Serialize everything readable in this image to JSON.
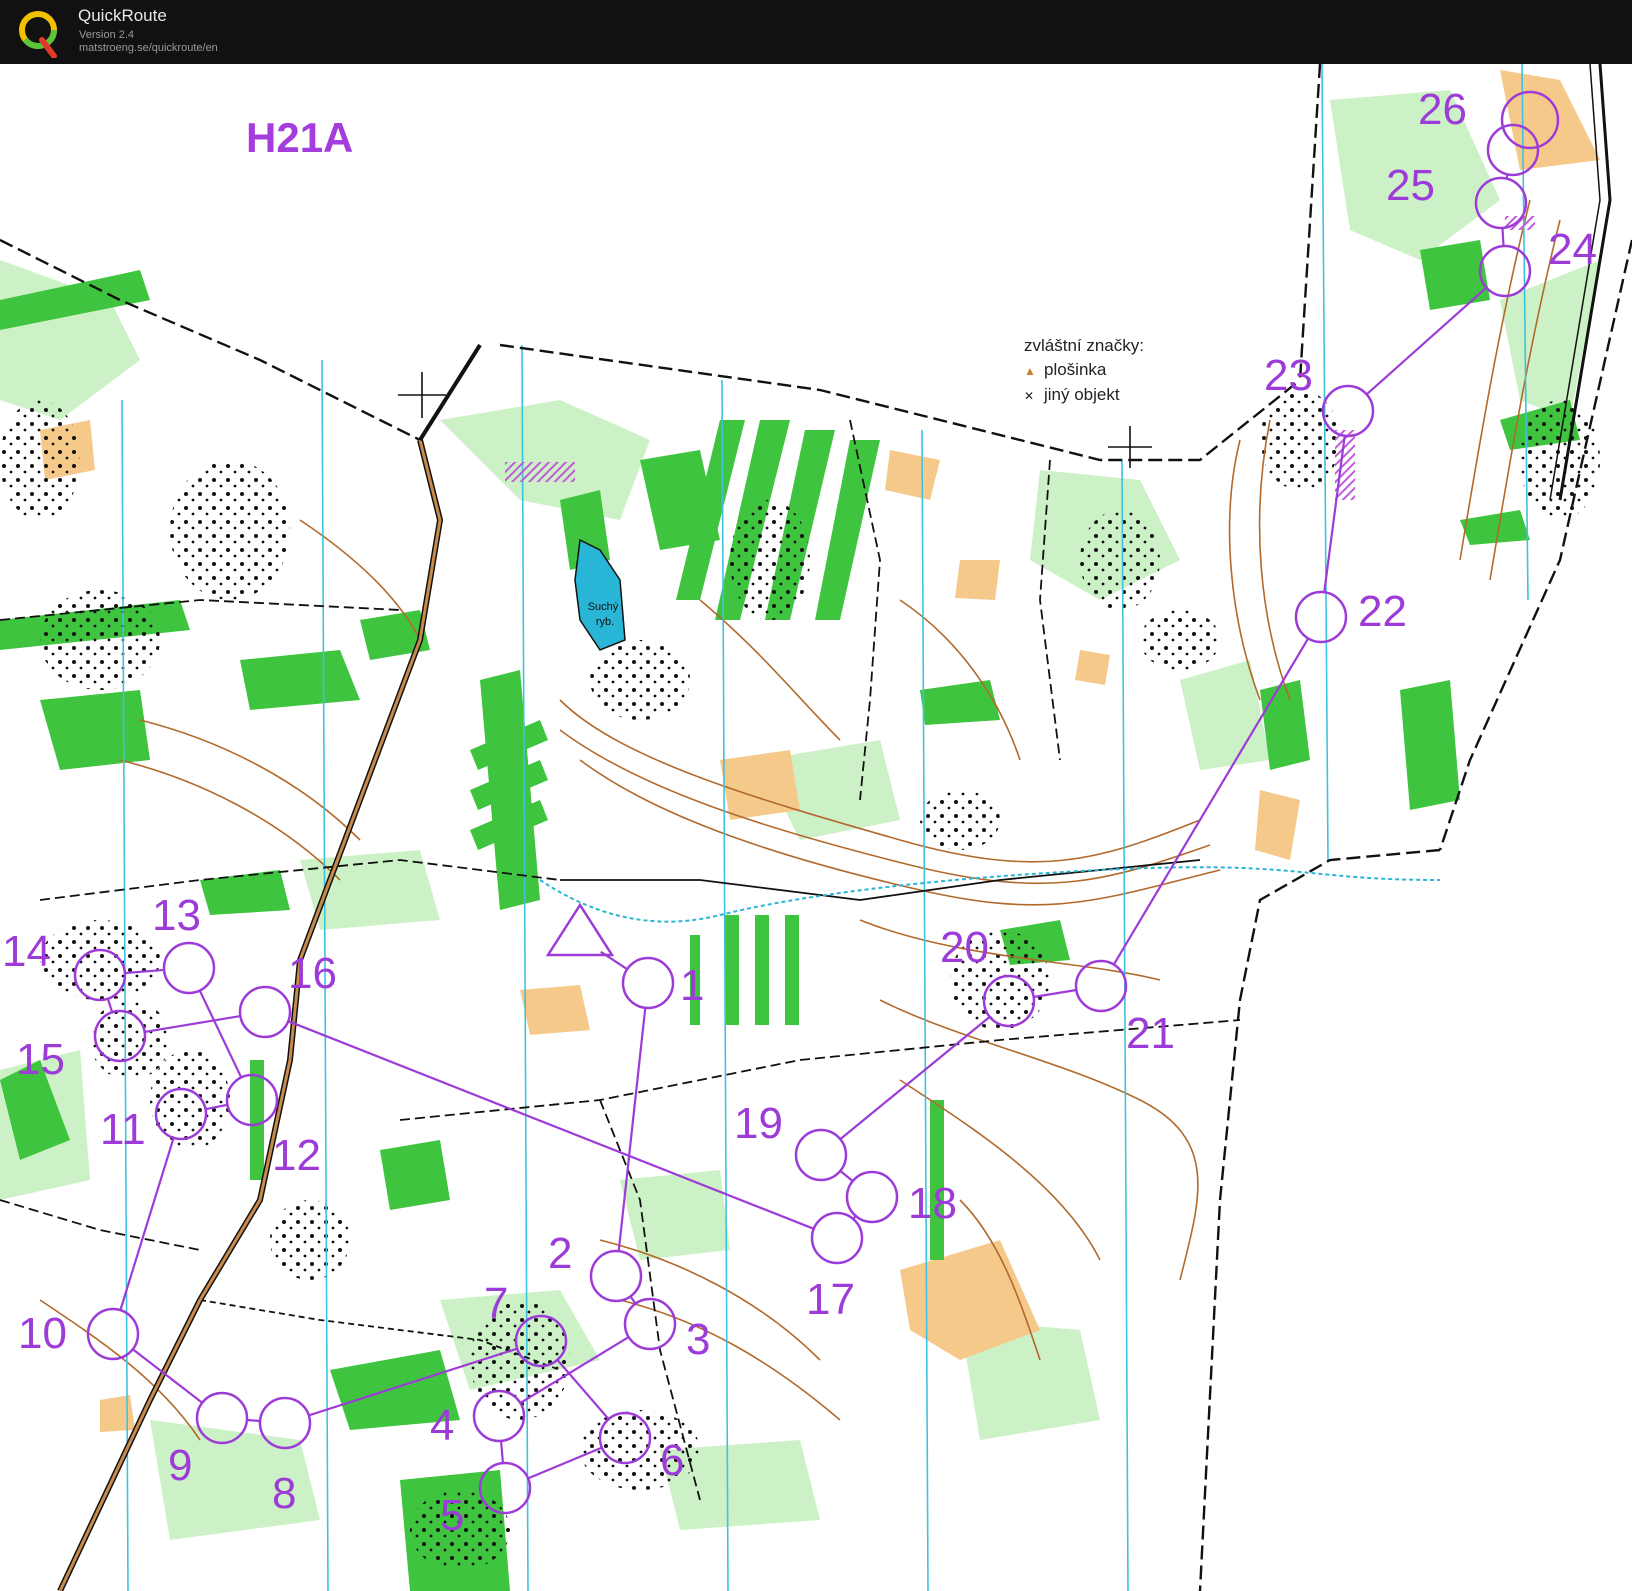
{
  "app": {
    "title": "QuickRoute",
    "version": "Version 2.4",
    "url": "matstroeng.se/quickroute/en"
  },
  "course": {
    "title": "H21A",
    "color": "#9d3bd8"
  },
  "legend": {
    "heading": "zvláštní značky:",
    "items": [
      {
        "symbol": "triangle",
        "label": "plošinka"
      },
      {
        "symbol": "cross",
        "label": "jiný objekt"
      }
    ]
  },
  "pond_label": [
    "Suchý",
    "ryb."
  ],
  "controls": [
    {
      "n": "1"
    },
    {
      "n": "2"
    },
    {
      "n": "3"
    },
    {
      "n": "4"
    },
    {
      "n": "5"
    },
    {
      "n": "6"
    },
    {
      "n": "7"
    },
    {
      "n": "8"
    },
    {
      "n": "9"
    },
    {
      "n": "10"
    },
    {
      "n": "11"
    },
    {
      "n": "12"
    },
    {
      "n": "13"
    },
    {
      "n": "14"
    },
    {
      "n": "15"
    },
    {
      "n": "16"
    },
    {
      "n": "17"
    },
    {
      "n": "18"
    },
    {
      "n": "19"
    },
    {
      "n": "20"
    },
    {
      "n": "21"
    },
    {
      "n": "22"
    },
    {
      "n": "23"
    },
    {
      "n": "24"
    },
    {
      "n": "25"
    },
    {
      "n": "26"
    }
  ],
  "colors": {
    "course": "#9d3bd8",
    "vegetation": "#3ec43e",
    "light_green": "#c8f0c0",
    "open_land": "#f5c98a",
    "contour": "#b26a2c",
    "water": "#29b6d6",
    "meridian": "#3fc2e0"
  }
}
